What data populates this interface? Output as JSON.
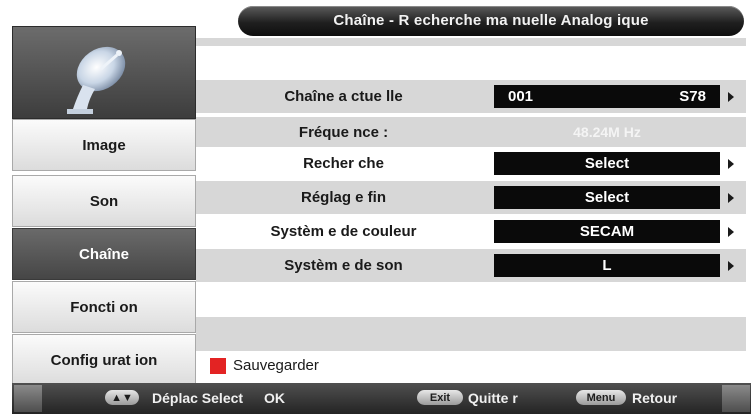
{
  "title": "Chaîne - R echerche ma nuelle Analog ique",
  "sidebar": {
    "items": [
      {
        "label": "Image"
      },
      {
        "label": "Son"
      },
      {
        "label": "Chaîne",
        "active": true
      },
      {
        "label": "Foncti on"
      },
      {
        "label": "Config urat ion"
      }
    ]
  },
  "settings": {
    "current_channel": {
      "label": "Chaîne a ctue lle",
      "number": "001",
      "name": "S78"
    },
    "frequency": {
      "label": "Fréque nce :",
      "value": "48.24M Hz"
    },
    "search": {
      "label": "Recher che",
      "value": "Select"
    },
    "fine_tune": {
      "label": "Réglag e fin",
      "value": "Select"
    },
    "color_system": {
      "label": "Systèm e de couleur",
      "value": "SECAM"
    },
    "sound_system": {
      "label": "Systèm e de son",
      "value": "L"
    }
  },
  "save": {
    "label": "Sauvegarder",
    "color": "#e32323"
  },
  "bottom_bar": {
    "nav_key": "▲▼",
    "nav_text": "Déplac Select",
    "ok_key": "OK",
    "exit_key": "Exit",
    "exit_text": "Quitte r",
    "menu_key": "Menu",
    "menu_text": "Retour"
  },
  "icons": {
    "sidebar_icon": "satellite-dish-icon"
  },
  "colors": {
    "active_menu": "#555555",
    "value_box": "#0a0a0a",
    "save_marker": "#e32323"
  }
}
